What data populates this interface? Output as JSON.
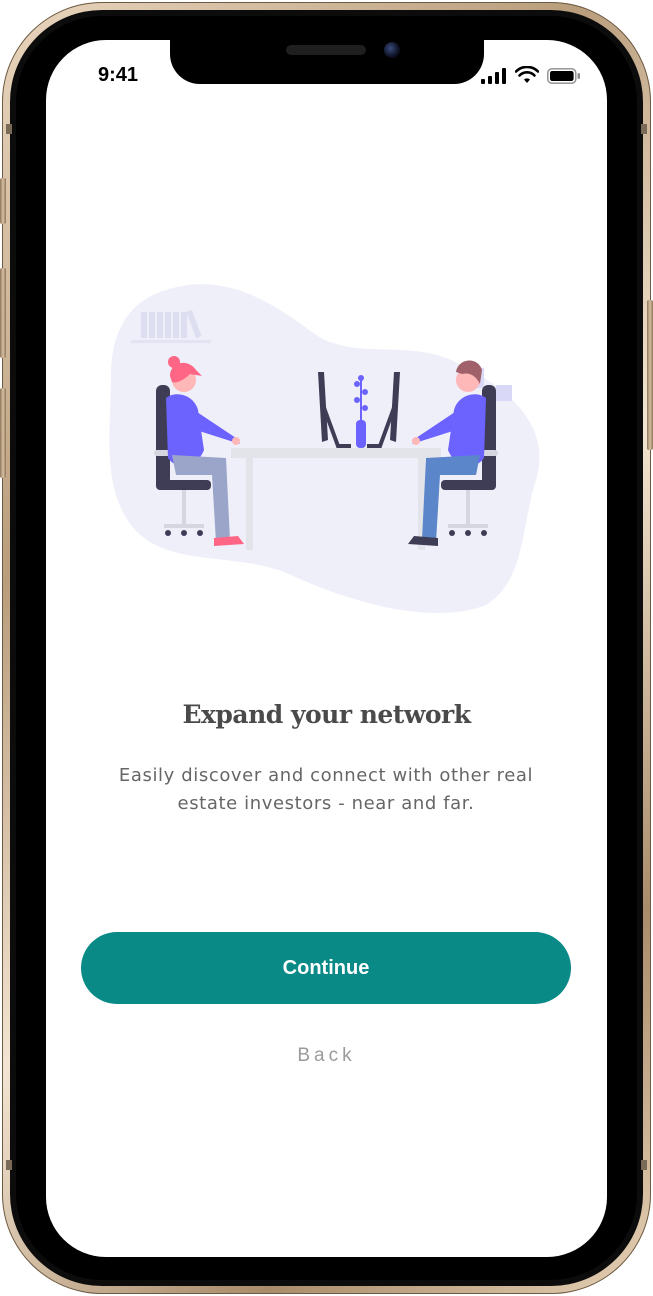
{
  "status_bar": {
    "time": "9:41"
  },
  "onboarding": {
    "title": "Expand your network",
    "subtitle": "Easily discover and connect with other real estate investors - near and far.",
    "continue_label": "Continue",
    "back_label": "Back"
  },
  "colors": {
    "accent": "#0a8a86",
    "title": "#4a4a4a",
    "subtitle": "#666666",
    "back": "#9b9b9b",
    "illustration_purple": "#6c63ff",
    "illustration_blob": "#efeffa"
  },
  "icons": [
    "signal-icon",
    "wifi-icon",
    "battery-icon"
  ]
}
